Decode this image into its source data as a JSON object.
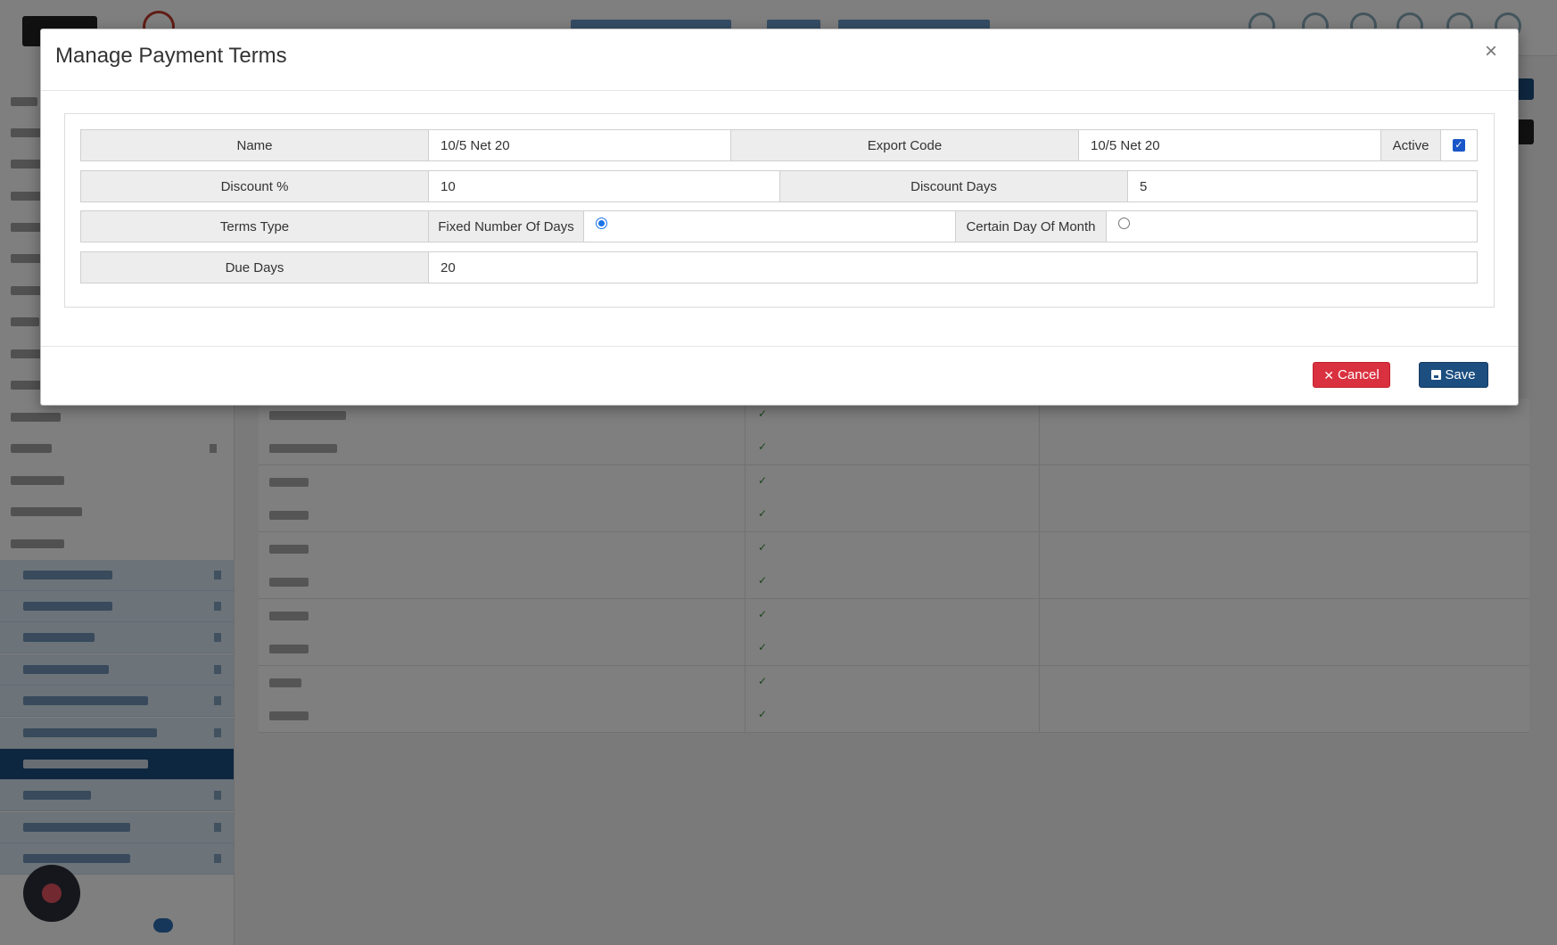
{
  "modal": {
    "title": "Manage Payment Terms",
    "close_glyph": "×",
    "fields": {
      "name_label": "Name",
      "name_value": "10/5 Net 20",
      "export_code_label": "Export Code",
      "export_code_value": "10/5 Net 20",
      "active_label": "Active",
      "active_checked": true,
      "discount_pct_label": "Discount %",
      "discount_pct_value": "10",
      "discount_days_label": "Discount Days",
      "discount_days_value": "5",
      "terms_type_label": "Terms Type",
      "terms_type_options": [
        {
          "label": "Fixed Number Of Days",
          "selected": true
        },
        {
          "label": "Certain Day Of Month",
          "selected": false
        }
      ],
      "due_days_label": "Due Days",
      "due_days_value": "20"
    },
    "footer": {
      "cancel_label": "Cancel",
      "cancel_icon": "times-icon",
      "save_label": "Save",
      "save_icon": "floppy-disk-icon"
    }
  },
  "colors": {
    "cancel": "#d9313f",
    "save": "#1c4e80",
    "overlay": "rgba(0,0,0,0.5)"
  }
}
